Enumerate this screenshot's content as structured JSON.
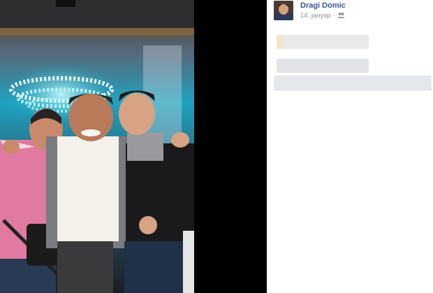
{
  "post": {
    "author_name": "Dragi Domic",
    "timestamp": "14. јануар",
    "separator": "·",
    "audience_icon": "friends-icon"
  },
  "photo": {
    "description_icon": "photo-image"
  },
  "colors": {
    "stage_background": "#000000",
    "author_link": "#365899",
    "meta_text": "#90949c"
  }
}
